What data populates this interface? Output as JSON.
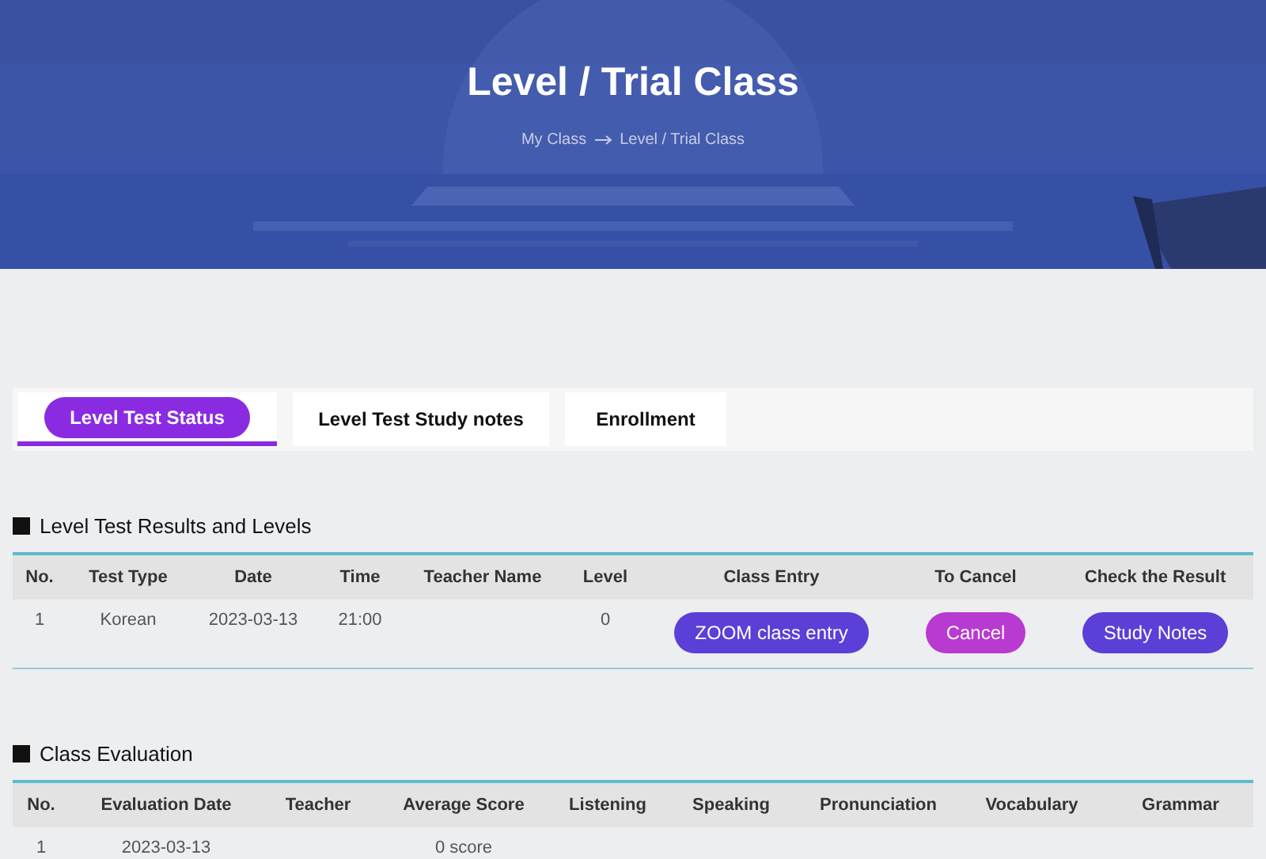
{
  "hero": {
    "title": "Level / Trial Class",
    "breadcrumb": [
      {
        "label": "My Class"
      },
      {
        "label": "Level / Trial Class"
      }
    ]
  },
  "tabs": [
    {
      "label": "Level Test Status",
      "selected": true
    },
    {
      "label": "Level Test Study notes",
      "selected": false
    },
    {
      "label": "Enrollment",
      "selected": false
    }
  ],
  "results": {
    "title": "Level Test Results and Levels",
    "columns": [
      "No.",
      "Test Type",
      "Date",
      "Time",
      "Teacher Name",
      "Level",
      "Class Entry",
      "To Cancel",
      "Check the Result"
    ],
    "rows": [
      [
        {
          "kind": "text",
          "text": "1"
        },
        {
          "kind": "text",
          "text": "Korean"
        },
        {
          "kind": "text",
          "text": "2023-03-13"
        },
        {
          "kind": "text",
          "text": "21:00"
        },
        {
          "kind": "empty"
        },
        {
          "kind": "text",
          "text": "0"
        },
        {
          "kind": "primary",
          "text": "ZOOM class entry"
        },
        {
          "kind": "danger",
          "text": "Cancel"
        },
        {
          "kind": "primary",
          "text": "Study Notes"
        }
      ]
    ]
  },
  "evaluation": {
    "title": "Class Evaluation",
    "columns": [
      "No.",
      "Evaluation Date",
      "Teacher",
      "Average Score",
      "Listening",
      "Speaking",
      "Pronunciation",
      "Vocabulary",
      "Grammar"
    ],
    "rows": [
      [
        {
          "kind": "text",
          "text": "1"
        },
        {
          "kind": "text",
          "text": "2023-03-13"
        },
        {
          "kind": "empty"
        },
        {
          "kind": "text",
          "text": "0 score"
        },
        {
          "kind": "empty"
        },
        {
          "kind": "empty"
        },
        {
          "kind": "empty"
        },
        {
          "kind": "empty"
        },
        {
          "kind": "empty"
        }
      ]
    ]
  }
}
